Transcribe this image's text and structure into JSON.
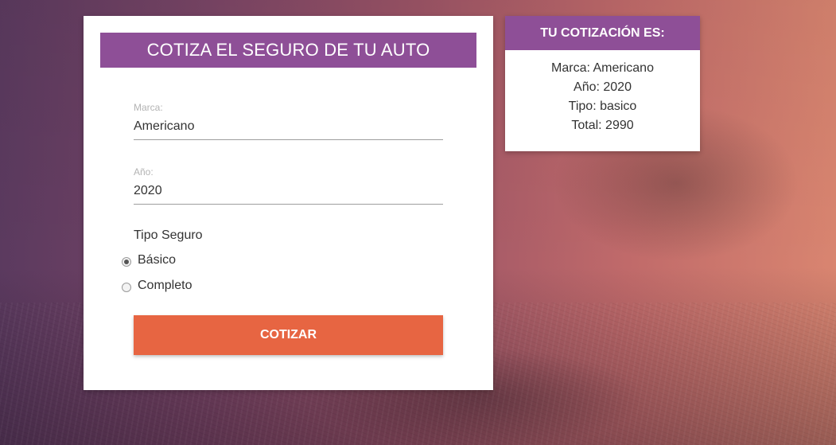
{
  "form": {
    "title": "COTIZA EL SEGURO DE TU AUTO",
    "marca": {
      "label": "Marca:",
      "value": "Americano"
    },
    "anio": {
      "label": "Año:",
      "value": "2020"
    },
    "tipo": {
      "title": "Tipo Seguro",
      "options": [
        {
          "label": "Básico",
          "checked": true
        },
        {
          "label": "Completo",
          "checked": false
        }
      ]
    },
    "submit_label": "COTIZAR"
  },
  "result": {
    "title": "TU COTIZACIÓN ES:",
    "lines": [
      "Marca: Americano",
      "Año: 2020",
      "Tipo: basico",
      "Total: 2990"
    ]
  },
  "colors": {
    "header_purple": "#8e4f97",
    "button_orange": "#e76542"
  }
}
